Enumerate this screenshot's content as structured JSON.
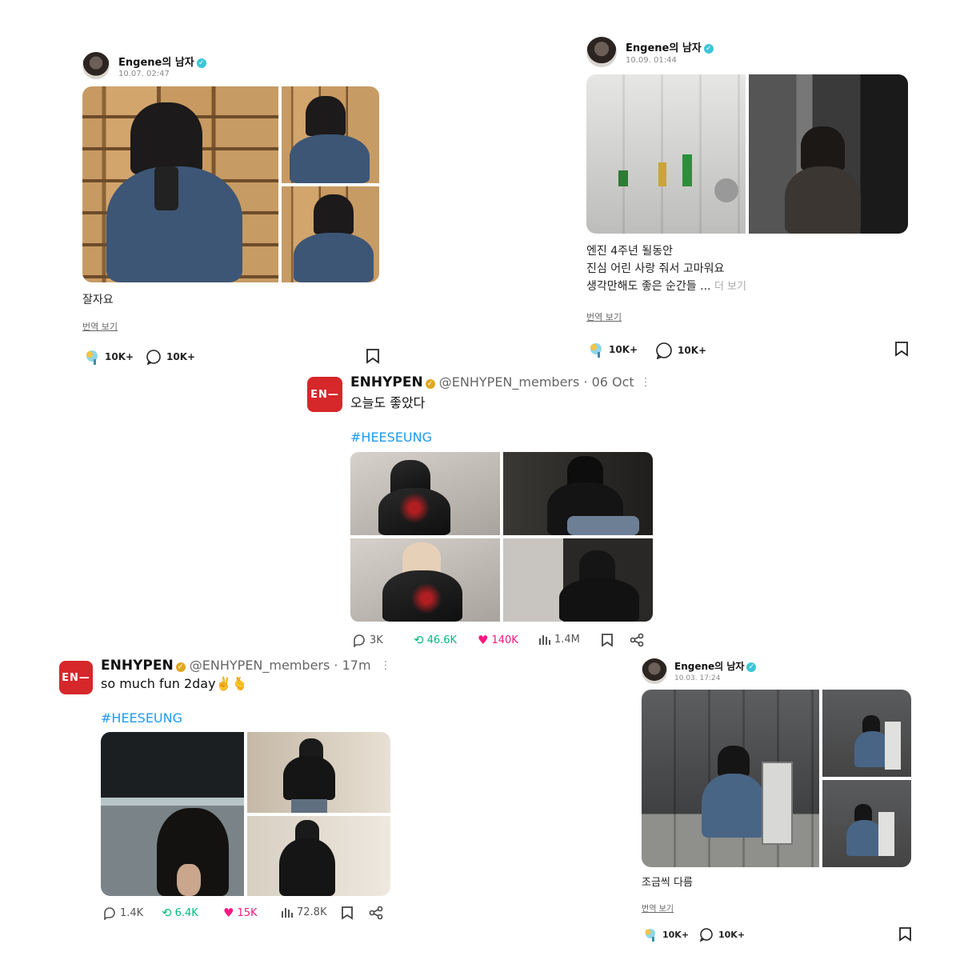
{
  "posts": {
    "wv1": {
      "author": "Engene의 남자",
      "date": "10.07. 02:47",
      "caption": "잘자요",
      "translate": "번역 보기",
      "likes": "10K+",
      "comments": "10K+"
    },
    "wv2": {
      "author": "Engene의 남자",
      "date": "10.09. 01:44",
      "caption_lines": [
        "엔진 4주년 될동안",
        "진심 어린 사랑 줘서 고마워요",
        "생각만해도 좋은 순간들 ..."
      ],
      "more": "더 보기",
      "translate": "번역 보기",
      "likes": "10K+",
      "comments": "10K+"
    },
    "tw1": {
      "logo": "EN—",
      "name": "ENHYPEN",
      "handle": "@ENHYPEN_members · 06 Oct",
      "text": "오늘도 좋았다",
      "hashtag": "#HEESEUNG",
      "replies": "3K",
      "retweets": "46.6K",
      "likes": "140K",
      "views": "1.4M"
    },
    "tw2": {
      "logo": "EN—",
      "name": "ENHYPEN",
      "handle": "@ENHYPEN_members · 17m",
      "text": "so much fun 2day✌️🫰",
      "hashtag": "#HEESEUNG",
      "replies": "1.4K",
      "retweets": "6.4K",
      "likes": "15K",
      "views": "72.8K"
    },
    "wv3": {
      "author": "Engene의 남자",
      "date": "10.03. 17:24",
      "caption": "조금씩 다름",
      "translate": "번역 보기",
      "likes": "10K+",
      "comments": "10K+"
    }
  },
  "colors": {
    "verified_weverse": "#3cc6d6",
    "verified_x": "#e0a820",
    "hashtag": "#1d9bf0",
    "retweet": "#00ba7c",
    "like": "#f91880"
  }
}
